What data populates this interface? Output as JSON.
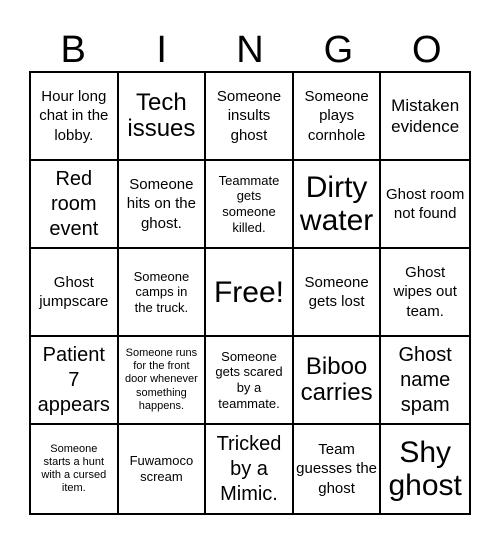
{
  "header": {
    "letters": [
      "B",
      "I",
      "N",
      "G",
      "O"
    ]
  },
  "card": {
    "rows": [
      [
        "Hour long chat in the lobby.",
        "Tech issues",
        "Someone insults ghost",
        "Someone plays cornhole",
        "Mistaken evidence"
      ],
      [
        "Red room event",
        "Someone hits on the ghost.",
        "Teammate gets someone killed.",
        "Dirty water",
        "Ghost room not found"
      ],
      [
        "Ghost jumpscare",
        "Someone camps in the truck.",
        "Free!",
        "Someone gets lost",
        "Ghost wipes out team."
      ],
      [
        "Patient 7 appears",
        "Someone runs for the front door whenever something happens.",
        "Someone gets scared by a teammate.",
        "Biboo carries",
        "Ghost name spam"
      ],
      [
        "Someone starts a hunt with a cursed item.",
        "Fuwamoco scream",
        "Tricked by a Mimic.",
        "Team guesses the ghost",
        "Shy ghost"
      ]
    ]
  }
}
